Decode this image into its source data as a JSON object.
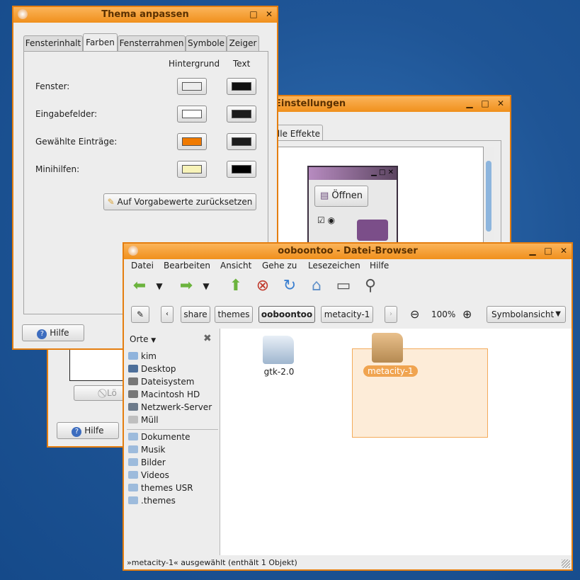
{
  "theme_window": {
    "title": "Thema anpassen",
    "tabs": [
      "Fensterinhalt",
      "Farben",
      "Fensterrahmen",
      "Symbole",
      "Zeiger"
    ],
    "active_tab": "Farben",
    "col_background": "Hintergrund",
    "col_text": "Text",
    "rows": [
      {
        "label": "Fenster:",
        "bg": "#ededed",
        "fg": "#111111"
      },
      {
        "label": "Eingabefelder:",
        "bg": "#ffffff",
        "fg": "#1c1c1c"
      },
      {
        "label": "Gewählte Einträge:",
        "bg": "#f07a00",
        "fg": "#1c1c1c"
      },
      {
        "label": "Minihilfen:",
        "bg": "#f7f3b8",
        "fg": "#000000"
      }
    ],
    "reset_label": "Auf Vorgabewerte zurücksetzen",
    "help_label": "Hilfe"
  },
  "settings_window": {
    "title_fragment": "Einstellungen",
    "tab_fragment": "lle Effekte",
    "preview_open_label": "Öffnen",
    "delete_fragment": "Lö",
    "help_label": "Hilfe"
  },
  "file_browser": {
    "title": "ooboontoo - Datei-Browser",
    "menu": [
      "Datei",
      "Bearbeiten",
      "Ansicht",
      "Gehe zu",
      "Lesezeichen",
      "Hilfe"
    ],
    "path": [
      "share",
      "themes",
      "ooboontoo",
      "metacity-1"
    ],
    "current_crumb": "ooboontoo",
    "zoom": "100%",
    "view_mode": "Symbolansicht",
    "sidebar_header": "Orte",
    "places": [
      "kim",
      "Desktop",
      "Dateisystem",
      "Macintosh HD",
      "Netzwerk-Server",
      "Müll"
    ],
    "bookmarks": [
      "Dokumente",
      "Musik",
      "Bilder",
      "Videos",
      "themes USR",
      ".themes"
    ],
    "items": [
      {
        "name": "gtk-2.0",
        "selected": false
      },
      {
        "name": "metacity-1",
        "selected": true
      }
    ],
    "status": "»metacity-1« ausgewählt (enthält 1 Objekt)",
    "accent": "#f09025"
  }
}
